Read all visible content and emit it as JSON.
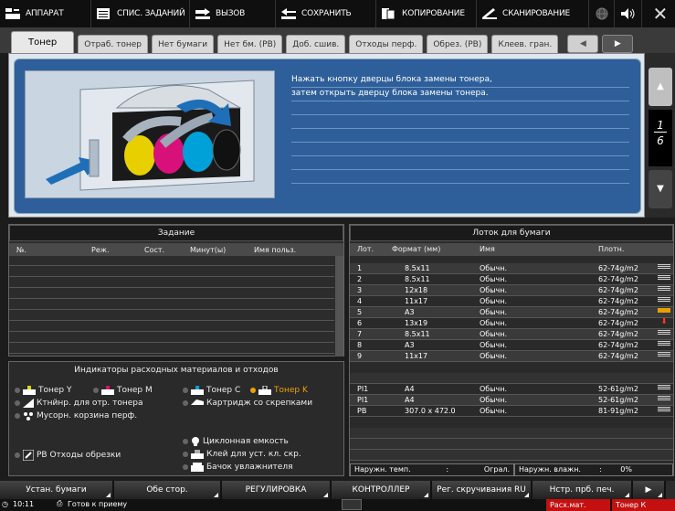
{
  "topbar": {
    "machine": "АППАРАТ",
    "job_list": "СПИС. ЗАДАНИЙ",
    "recall": "ВЫЗОВ",
    "save": "СОХРАНИТЬ",
    "copy": "КОПИРОВАНИЕ",
    "scan": "СКАНИРОВАНИЕ"
  },
  "tabs": [
    "Тонер",
    "Отраб. тонер",
    "Нет бумаги",
    "Нет бм. (PB)",
    "Доб. сшив.",
    "Отходы перф.",
    "Обрез. (PB)",
    "Клеев. гран."
  ],
  "guide": {
    "message_line1": "Нажать кнопку дверцы блока замены тонера,",
    "message_line2": "затем открыть дверцу блока замены тонера.",
    "page_current": "1",
    "page_total": "6"
  },
  "job": {
    "title": "Задание",
    "columns": [
      "№.",
      "Реж.",
      "Сост.",
      "Минут(ы)",
      "Имя польз."
    ]
  },
  "consumables": {
    "title": "Индикаторы расходных материалов и отходов",
    "toner_y": "Тонер Y",
    "toner_m": "Тонер M",
    "toner_c": "Тонер C",
    "toner_k": "Тонер K",
    "waste_toner": "Ктнйнр. для отр. тонера",
    "staple": "Картридж со скрепками",
    "punch": "Мусорн. корзина перф.",
    "cyclone": "Циклонная емкость",
    "pb_trim": "PB Отходы обрезки",
    "glue": "Клей для уст. кл. скр.",
    "humid": "Бачок увлажнителя",
    "accent_color": "#f0a000"
  },
  "tray": {
    "title": "Лоток для бумаги",
    "columns": [
      "Лот.",
      "Формат (мм)",
      "Имя",
      "Плотн."
    ],
    "rows": [
      {
        "tray": "1",
        "size": "8.5x11",
        "name": "Обычн.",
        "weight": "62-74g/m2"
      },
      {
        "tray": "2",
        "size": "8.5x11",
        "name": "Обычн.",
        "weight": "62-74g/m2"
      },
      {
        "tray": "3",
        "size": "12x18",
        "name": "Обычн.",
        "weight": "62-74g/m2"
      },
      {
        "tray": "4",
        "size": "11x17",
        "name": "Обычн.",
        "weight": "62-74g/m2"
      },
      {
        "tray": "5",
        "size": "A3",
        "name": "Обычн.",
        "weight": "62-74g/m2"
      },
      {
        "tray": "6",
        "size": "13x19",
        "name": "Обычн.",
        "weight": "62-74g/m2"
      },
      {
        "tray": "7",
        "size": "8.5x11",
        "name": "Обычн.",
        "weight": "62-74g/m2"
      },
      {
        "tray": "8",
        "size": "A3",
        "name": "Обычн.",
        "weight": "62-74g/m2"
      },
      {
        "tray": "9",
        "size": "11x17",
        "name": "Обычн.",
        "weight": "62-74g/m2"
      },
      {
        "tray": "PI1",
        "size": "A4",
        "name": "Обычн.",
        "weight": "52-61g/m2"
      },
      {
        "tray": "PI1",
        "size": "A4",
        "name": "Обычн.",
        "weight": "52-61g/m2"
      },
      {
        "tray": "PB",
        "size": "307.0 x 472.0",
        "name": "Обычн.",
        "weight": "81-91g/m2"
      }
    ],
    "outside_temp_label": "Наружн. темп.",
    "outside_temp_value": "Ограл.",
    "humidity_label": "Наружн. влажн.",
    "humidity_value": "0%"
  },
  "bottom": {
    "paper_setting": "Устан. бумаги",
    "duplex": "Обе стор.",
    "adjust": "РЕГУЛИРОВКА",
    "controller": "КОНТРОЛЛЕР",
    "curl": "Рег. скручивания RU",
    "print_settings": "Нстр. прб. печ."
  },
  "statusbar": {
    "time": "10:11",
    "state": "Готов к приему",
    "alert1": "Расх.мат.",
    "alert2": "Тонер К",
    "alert_color": "#c41010"
  }
}
